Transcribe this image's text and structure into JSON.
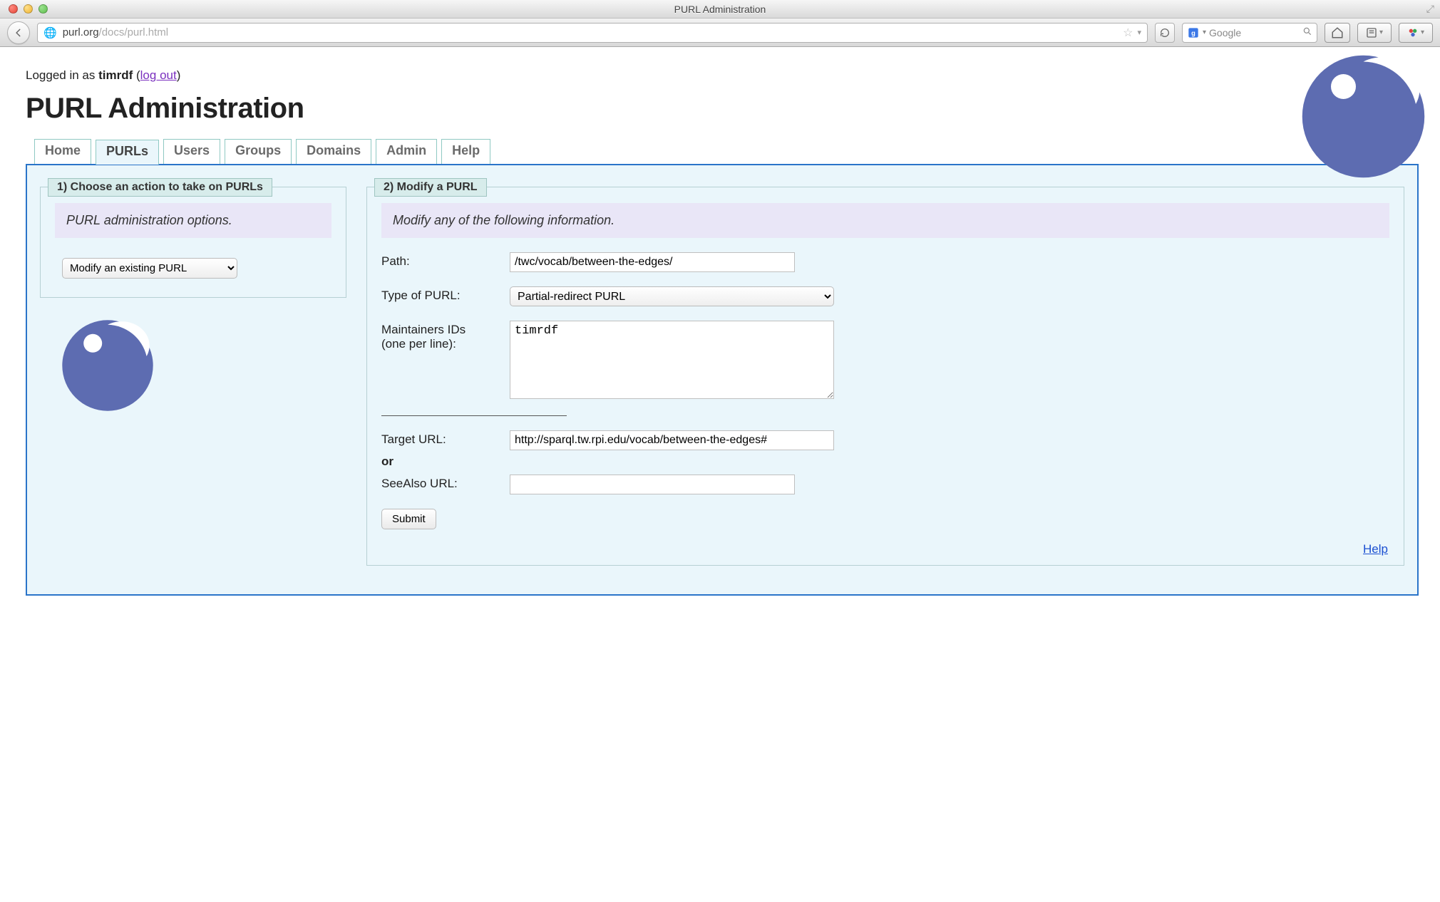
{
  "window": {
    "title": "PURL Administration"
  },
  "browser": {
    "url_display_dark": "purl.org",
    "url_display_gray": "/docs/purl.html",
    "search_placeholder": "Google"
  },
  "login": {
    "prefix": "Logged in as ",
    "username": "timrdf",
    "paren_open": " (",
    "logout_label": "log out",
    "paren_close": ")"
  },
  "page_title": "PURL Administration",
  "tabs": [
    "Home",
    "PURLs",
    "Users",
    "Groups",
    "Domains",
    "Admin",
    "Help"
  ],
  "active_tab_index": 1,
  "panel_left": {
    "legend": "1) Choose an action to take on PURLs",
    "banner": "PURL administration options.",
    "action_selected": "Modify an existing PURL"
  },
  "panel_right": {
    "legend": "2) Modify a PURL",
    "banner": "Modify any of the following information.",
    "labels": {
      "path": "Path:",
      "type": "Type of PURL:",
      "maintainers_l1": "Maintainers IDs",
      "maintainers_l2": "(one per line):",
      "target": "Target URL:",
      "or": "or",
      "seealso": "SeeAlso URL:"
    },
    "values": {
      "path": "/twc/vocab/between-the-edges/",
      "type": "Partial-redirect PURL",
      "maintainers": "timrdf",
      "target": "http://sparql.tw.rpi.edu/vocab/between-the-edges#",
      "seealso": ""
    },
    "submit_label": "Submit",
    "help_label": "Help"
  }
}
